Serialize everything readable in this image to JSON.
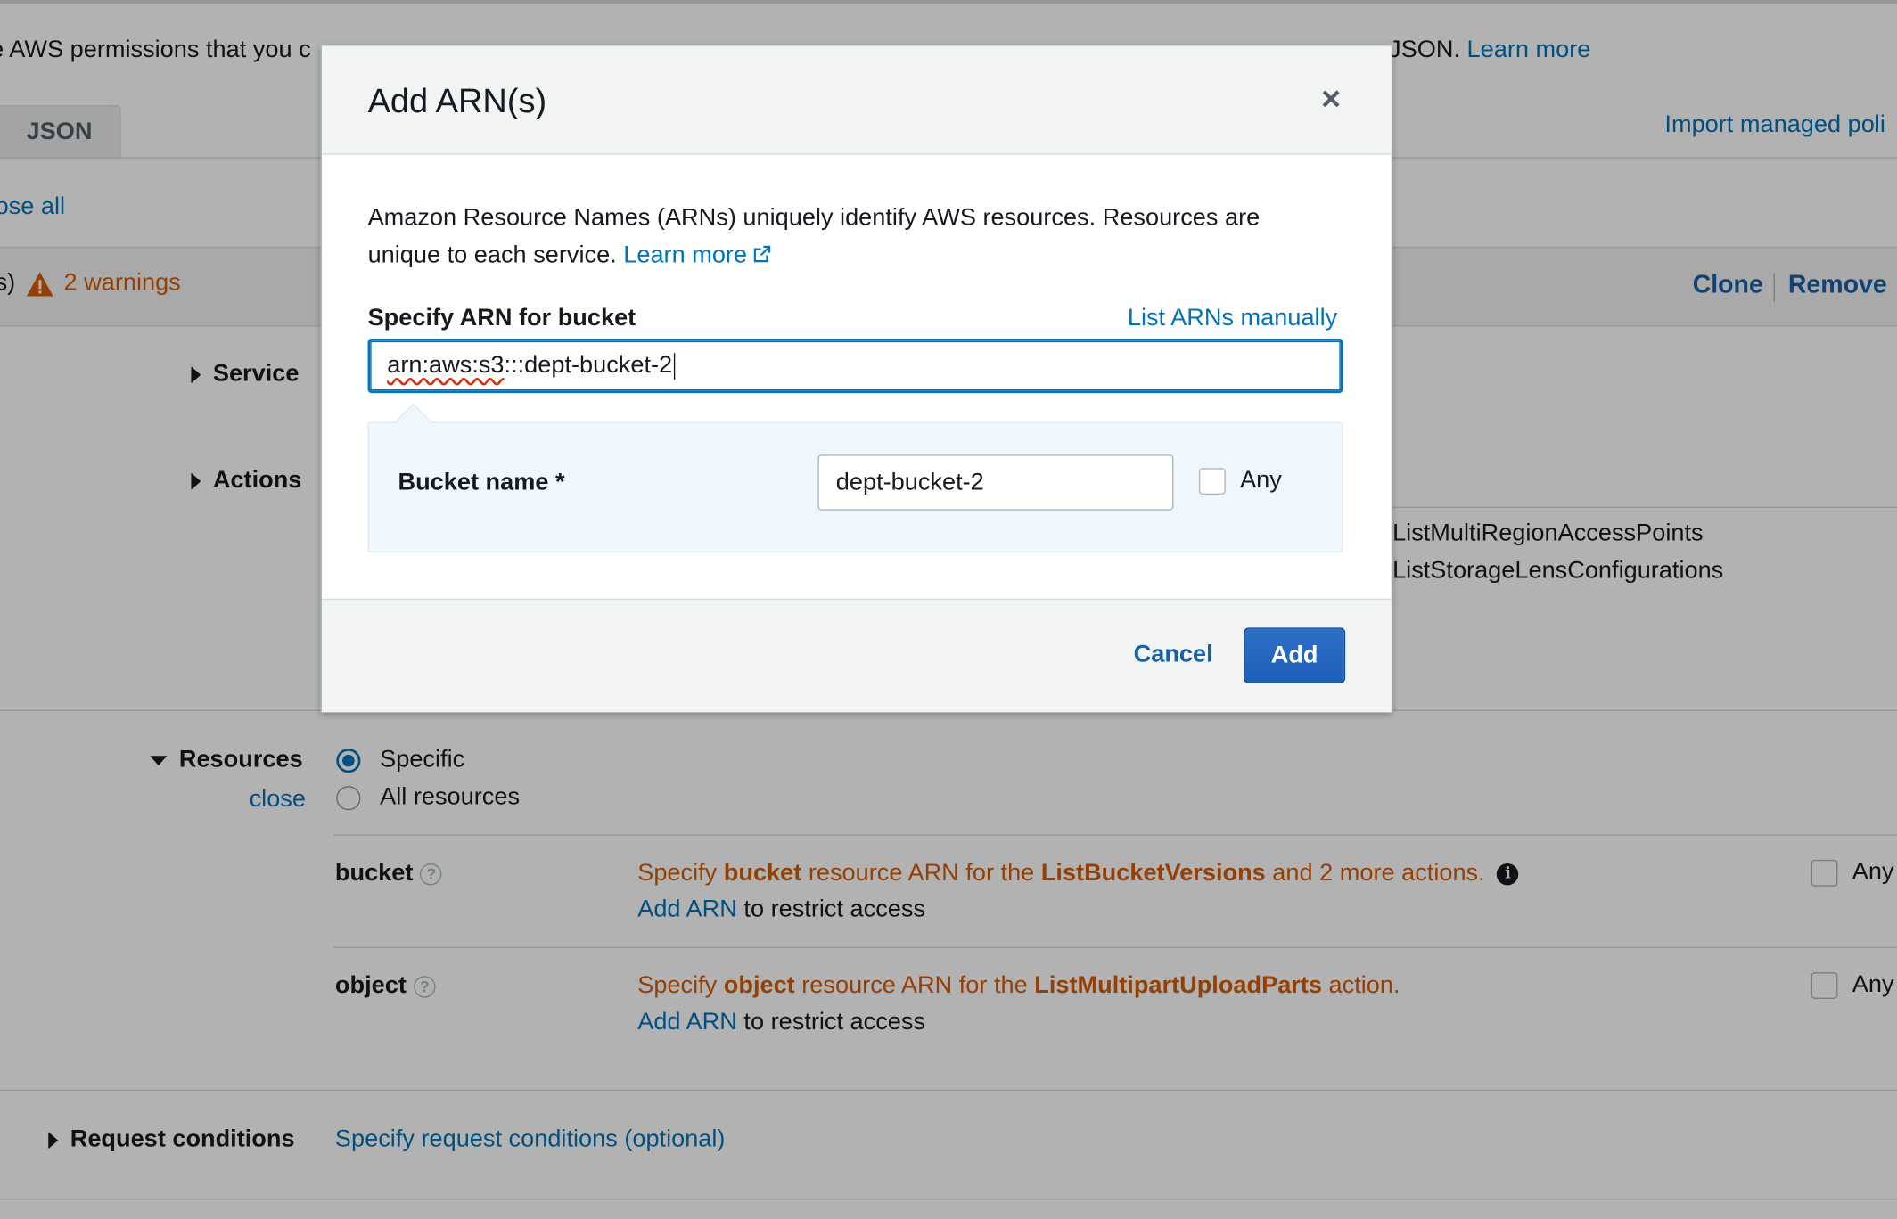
{
  "background": {
    "description_text": "e AWS permissions that you c",
    "description_hidden_tail": "JSON.",
    "learn_more": "Learn more",
    "json_tab": "JSON",
    "import_link": "Import managed poli",
    "collapse_all": "ose all",
    "statement_prefix": "s)",
    "warnings": "2 warnings",
    "clone": "Clone",
    "remove": "Remove",
    "service_label": "Service",
    "actions_label": "Actions",
    "action_items": [
      "ListMultiRegionAccessPoints",
      "ListStorageLensConfigurations"
    ],
    "resources_label": "Resources",
    "resources_close": "close",
    "radio_specific": "Specific",
    "radio_all": "All resources",
    "resources": [
      {
        "name": "bucket",
        "msg_pre": "Specify ",
        "msg_type": "bucket",
        "msg_mid": " resource ARN for the ",
        "msg_action": "ListBucketVersions",
        "msg_post": " and 2 more actions.",
        "add_arn": "Add ARN",
        "restrict": " to restrict access",
        "any": "Any"
      },
      {
        "name": "object",
        "msg_pre": "Specify ",
        "msg_type": "object",
        "msg_mid": " resource ARN for the ",
        "msg_action": "ListMultipartUploadParts",
        "msg_post": " action.",
        "add_arn": "Add ARN",
        "restrict": " to restrict access",
        "any": "Any"
      }
    ],
    "request_conditions_label": "Request conditions",
    "request_conditions_link": "Specify request conditions (optional)"
  },
  "modal": {
    "title": "Add ARN(s)",
    "close_glyph": "×",
    "description": "Amazon Resource Names (ARNs) uniquely identify AWS resources. Resources are unique to each service.",
    "learn_more": "Learn more",
    "specify_label": "Specify ARN for bucket",
    "list_manually": "List ARNs manually",
    "arn_prefix": "arn:aws:s3",
    "arn_rest": ":::dept-bucket-2",
    "bucket_name_label": "Bucket name *",
    "bucket_name_value": "dept-bucket-2",
    "any_label": "Any",
    "cancel": "Cancel",
    "add": "Add"
  },
  "colors": {
    "link": "#0073bb",
    "warning": "#d45b07",
    "primary_button": "#1e5fb8"
  }
}
